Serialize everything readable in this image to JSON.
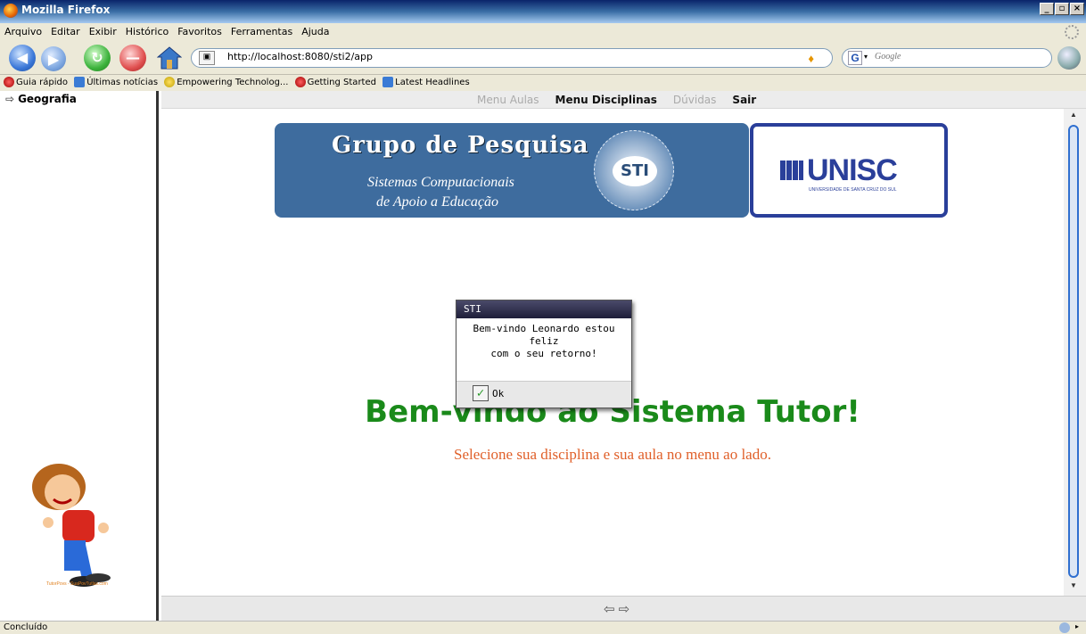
{
  "window": {
    "title": "Mozilla Firefox",
    "buttons": [
      "_",
      "▫",
      "×"
    ]
  },
  "menubar": {
    "items": [
      "Arquivo",
      "Editar",
      "Exibir",
      "Histórico",
      "Favoritos",
      "Ferramentas",
      "Ajuda"
    ]
  },
  "navbar": {
    "url": "http://localhost:8080/sti2/app",
    "search_placeholder": "Google",
    "search_engine_letter": "G"
  },
  "bookmarks": [
    {
      "label": "Guia rápido",
      "icon": "red-hat-icon"
    },
    {
      "label": "Últimas notícias",
      "icon": "rss-feed-icon"
    },
    {
      "label": "Empowering Technolog...",
      "icon": "bulb-icon"
    },
    {
      "label": "Getting Started",
      "icon": "red-hat-icon"
    },
    {
      "label": "Latest Headlines",
      "icon": "rss-feed-icon"
    }
  ],
  "left_frame": {
    "title": "Geografia",
    "mascot_caption": "TutorPovs - SuaPovTutlas.com"
  },
  "top_menu": {
    "items": [
      {
        "label": "Menu Aulas",
        "active": false
      },
      {
        "label": "Menu Disciplinas",
        "active": true
      },
      {
        "label": "Dúvidas",
        "active": false
      },
      {
        "label": "Sair",
        "active": true
      }
    ]
  },
  "banner": {
    "heading": "Grupo de Pesquisa",
    "subtitle_line1": "Sistemas Computacionais",
    "subtitle_line2": "de Apoio a Educação",
    "logo_text": "STI",
    "university": "UNISC",
    "university_sub": "UNIVERSIDADE DE SANTA CRUZ DO SUL"
  },
  "main": {
    "welcome": "Bem-vindo ao Sistema Tutor!",
    "instruction": "Selecione sua disciplina e sua aula no menu ao lado."
  },
  "dialog": {
    "title": "STI",
    "message_line1": "Bem-vindo Leonardo estou feliz",
    "message_line2": "com o seu retorno!",
    "ok_label": "Ok"
  },
  "status": {
    "text": "Concluído"
  },
  "colors": {
    "welcome": "#1a8a1a",
    "instruction": "#e0602a",
    "banner_bg": "#3e6c9e",
    "unisc_blue": "#2a3f9a"
  }
}
